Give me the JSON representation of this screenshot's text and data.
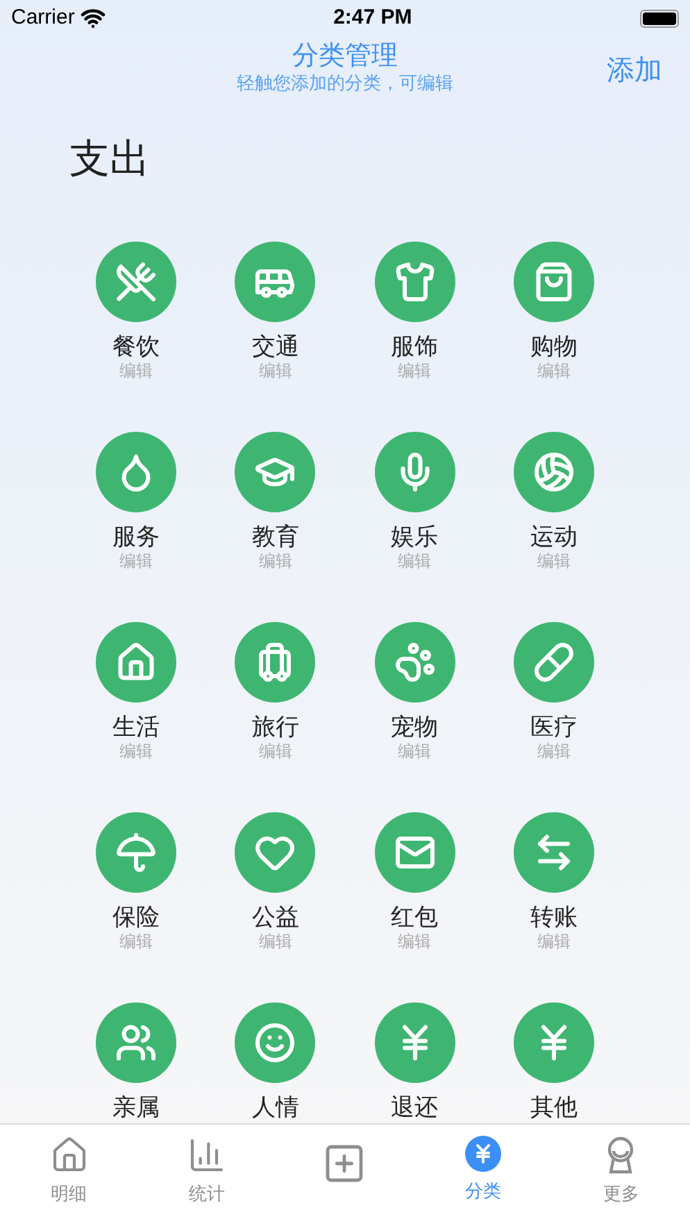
{
  "status_bar": {
    "carrier": "Carrier",
    "time": "2:47 PM"
  },
  "nav": {
    "title": "分类管理",
    "subtitle": "轻触您添加的分类，可编辑",
    "action": "添加"
  },
  "section": {
    "title": "支出"
  },
  "categories": [
    {
      "name": "餐饮",
      "hint": "编辑"
    },
    {
      "name": "交通",
      "hint": "编辑"
    },
    {
      "name": "服饰",
      "hint": "编辑"
    },
    {
      "name": "购物",
      "hint": "编辑"
    },
    {
      "name": "服务",
      "hint": "编辑"
    },
    {
      "name": "教育",
      "hint": "编辑"
    },
    {
      "name": "娱乐",
      "hint": "编辑"
    },
    {
      "name": "运动",
      "hint": "编辑"
    },
    {
      "name": "生活",
      "hint": "编辑"
    },
    {
      "name": "旅行",
      "hint": "编辑"
    },
    {
      "name": "宠物",
      "hint": "编辑"
    },
    {
      "name": "医疗",
      "hint": "编辑"
    },
    {
      "name": "保险",
      "hint": "编辑"
    },
    {
      "name": "公益",
      "hint": "编辑"
    },
    {
      "name": "红包",
      "hint": "编辑"
    },
    {
      "name": "转账",
      "hint": "编辑"
    },
    {
      "name": "亲属"
    },
    {
      "name": "人情"
    },
    {
      "name": "退还"
    },
    {
      "name": "其他"
    }
  ],
  "tab_bar": [
    {
      "kind": "tab",
      "label": "明细",
      "selected": false
    },
    {
      "kind": "tab",
      "label": "统计",
      "selected": false
    },
    {
      "kind": "add",
      "selected": false
    },
    {
      "kind": "tab",
      "label": "分类",
      "selected": true
    },
    {
      "kind": "tab",
      "label": "更多",
      "selected": false
    }
  ]
}
